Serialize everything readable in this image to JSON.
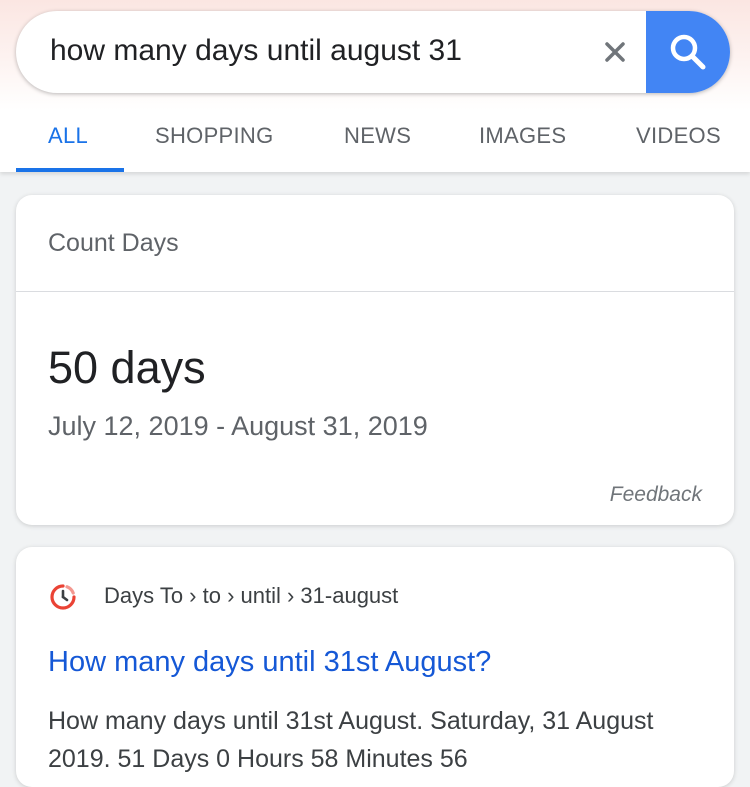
{
  "search": {
    "query": "how many days until august 31",
    "clear_icon": "close-icon",
    "submit_icon": "search-icon",
    "accent": "#4285f4"
  },
  "tabs": [
    {
      "label": "ALL",
      "active": true
    },
    {
      "label": "SHOPPING",
      "active": false
    },
    {
      "label": "NEWS",
      "active": false
    },
    {
      "label": "IMAGES",
      "active": false
    },
    {
      "label": "VIDEOS",
      "active": false
    }
  ],
  "count_card": {
    "header": "Count Days",
    "result": "50 days",
    "range": "July 12, 2019 - August 31, 2019",
    "feedback": "Feedback"
  },
  "result_card": {
    "site_icon": "clock-icon",
    "site_icon_color": "#ea4335",
    "breadcrumb": "Days To › to › until › 31-august",
    "title": "How many days until 31st August?",
    "snippet": "How many days until 31st August. Saturday, 31 August 2019. 51 Days 0 Hours 58 Minutes 56"
  },
  "colors": {
    "link": "#1558d6",
    "active_tab": "#1a73e8"
  }
}
